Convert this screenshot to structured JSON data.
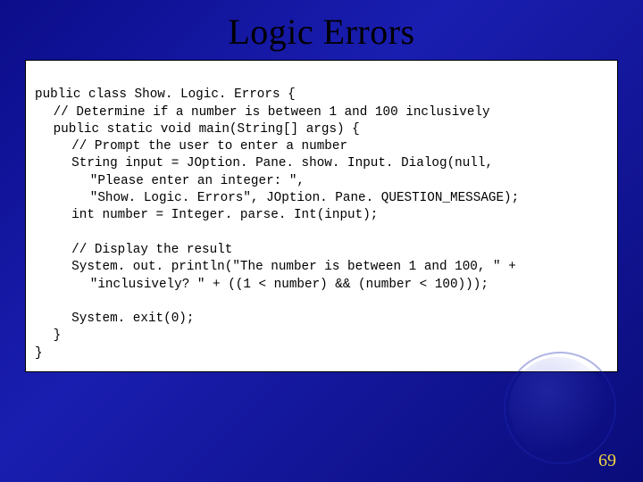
{
  "title": "Logic Errors",
  "slide_number": "69",
  "code": {
    "l1": "public class Show. Logic. Errors {",
    "l2": "// Determine if a number is between 1 and 100 inclusively",
    "l3": "public static void main(String[] args) {",
    "l4": "// Prompt the user to enter a number",
    "l5": "String input = JOption. Pane. show. Input. Dialog(null,",
    "l6": "\"Please enter an integer: \",",
    "l7": "\"Show. Logic. Errors\", JOption. Pane. QUESTION_MESSAGE);",
    "l8": "int number = Integer. parse. Int(input);",
    "l9": "",
    "l10": "// Display the result",
    "l11": "System. out. println(\"The number is between 1 and 100, \" +",
    "l12": "\"inclusively? \" + ((1 < number) && (number < 100)));",
    "l13": "",
    "l14": "System. exit(0);",
    "l15": "}",
    "l16": "}"
  }
}
